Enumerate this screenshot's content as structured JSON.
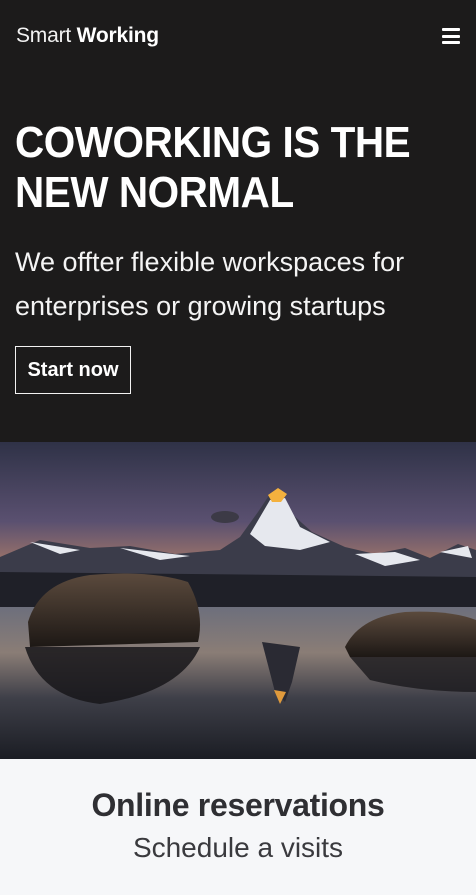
{
  "nav": {
    "brand_light": "Smart",
    "brand_bold": "Working",
    "menu_icon": "hamburger-menu-icon"
  },
  "hero": {
    "headline": "COWORKING IS THE NEW NORMAL",
    "subtitle": "We offter flexible workspaces for enterprises or growing startups",
    "cta_label": "Start now"
  },
  "image": {
    "alt": "Mountain peak at sunset reflected in a lake"
  },
  "reservations": {
    "title": "Online reservations",
    "subtitle": "Schedule a visits"
  },
  "colors": {
    "hero_background": "#1c1b1b",
    "section_background": "#f6f7f9",
    "text_dark": "#2f2f33"
  }
}
